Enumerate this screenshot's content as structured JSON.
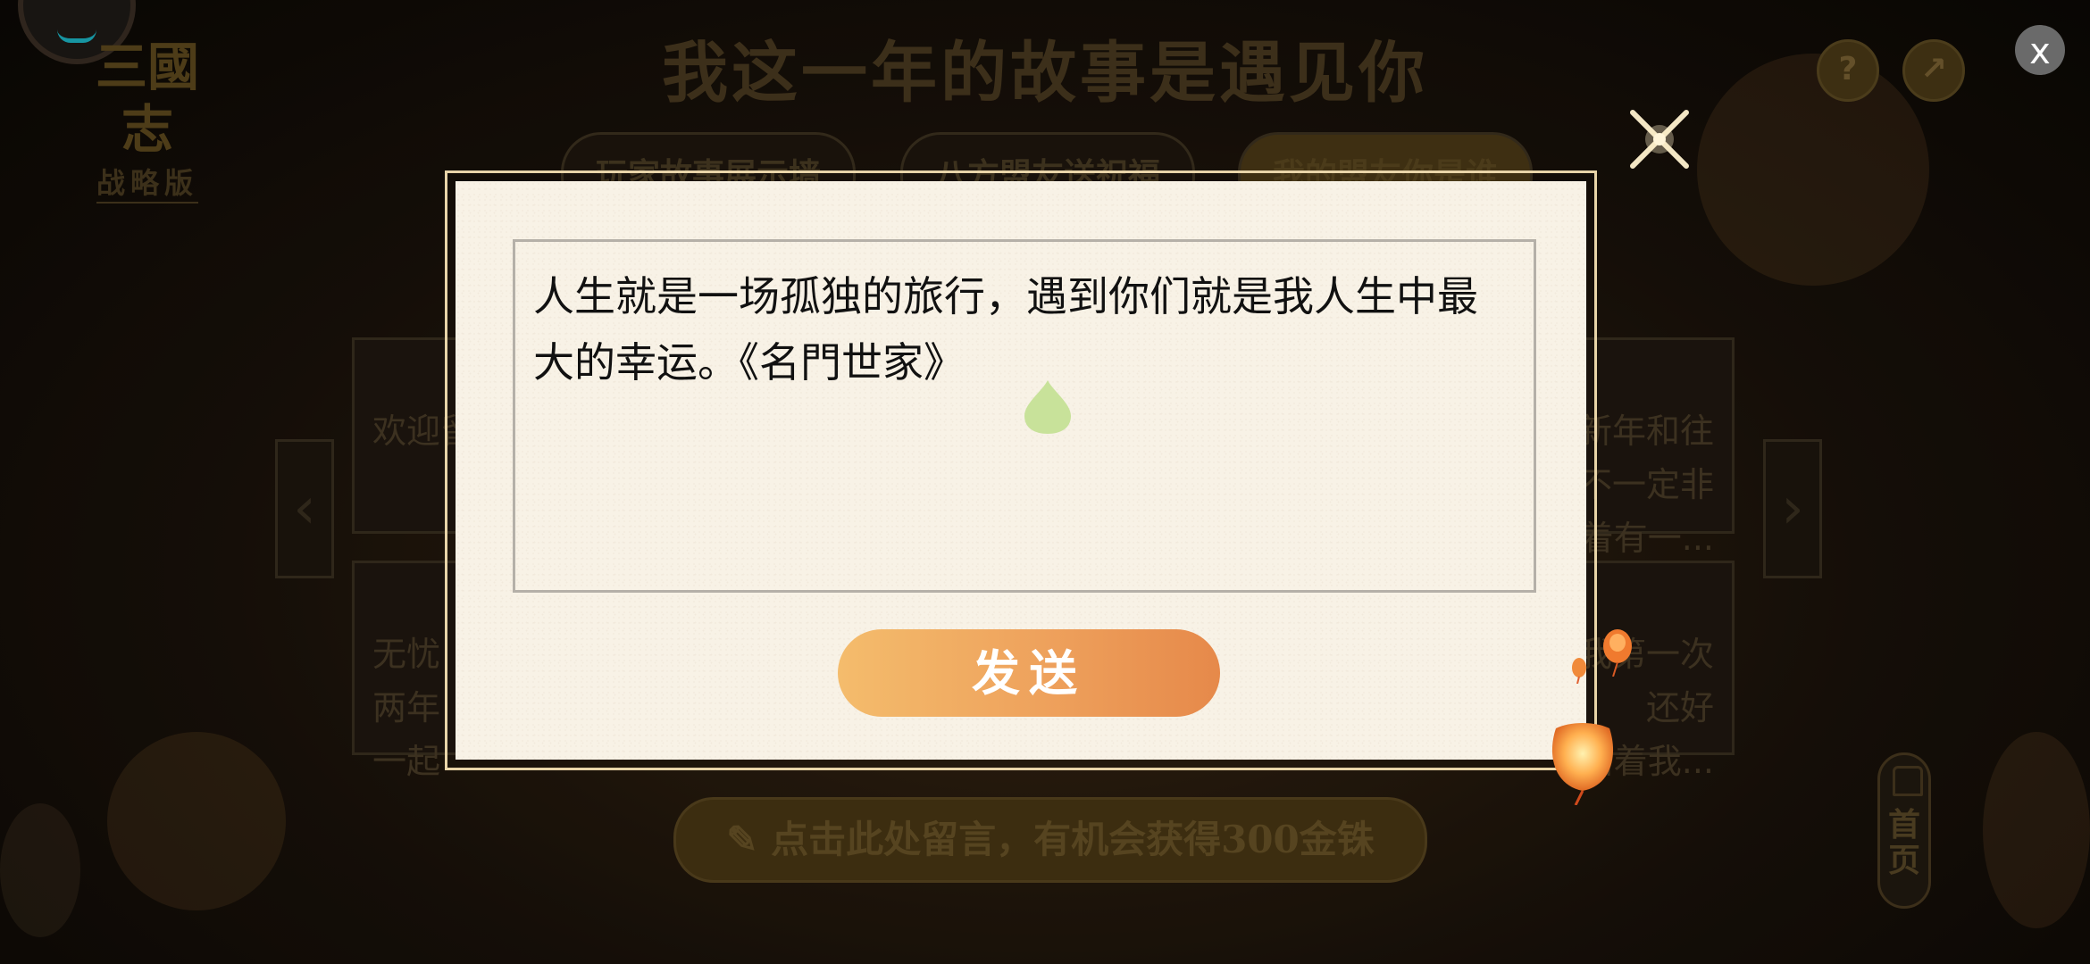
{
  "app": {
    "logo_mark": "三國志",
    "logo_sub": "战略版",
    "title": "我这一年的故事是遇见你"
  },
  "header": {
    "help_label": "?",
    "share_label": "↗",
    "close_label": "x"
  },
  "tabs": [
    {
      "label": "玩家故事展示墙"
    },
    {
      "label": "八方盟友送祝福"
    },
    {
      "label": "我的盟友你是谁"
    }
  ],
  "cards": {
    "left": [
      {
        "text": "欢迎留"
      },
      {
        "text": "无忧\n两年\n一起"
      }
    ],
    "right": [
      {
        "text": "新年和往\n不一定非\n着有一..."
      },
      {
        "text": "我第一次\n还好\n陪着我..."
      }
    ]
  },
  "nav": {
    "prev_label": "‹",
    "next_label": "›"
  },
  "bottom": {
    "comment_label": "点击此处留言，有机会获得300金铢",
    "home_label": "首\n页"
  },
  "modal": {
    "textarea_value": "人生就是一场孤独的旅行，遇到你们就是我人生中最大的幸运。《名門世家》",
    "send_label": "发送",
    "close_icon": "sparkle-x-icon"
  },
  "colors": {
    "send_gradient_start": "#f4bc6c",
    "send_gradient_end": "#e6894a",
    "modal_bg": "#f8f2e6",
    "drop_green": "#c8e29a"
  }
}
